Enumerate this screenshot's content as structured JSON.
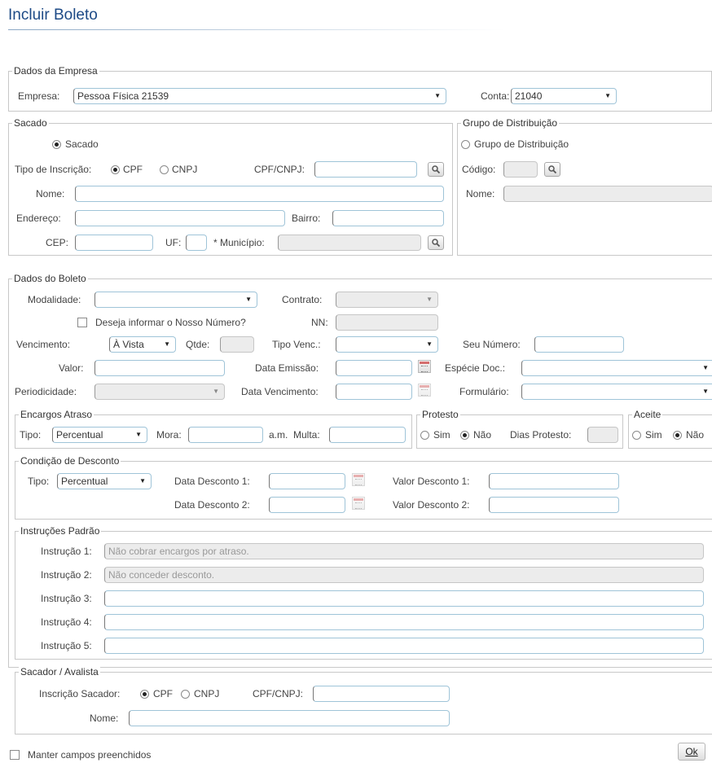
{
  "page": {
    "title": "Incluir Boleto"
  },
  "empresa_section": {
    "legend": "Dados da Empresa",
    "empresa_label": "Empresa:",
    "empresa_value": "Pessoa Física 21539",
    "conta_label": "Conta:",
    "conta_value": "21040"
  },
  "sacado_section": {
    "legend": "Sacado",
    "sacado_radio": "Sacado",
    "tipo_label": "Tipo de Inscrição:",
    "cpf": "CPF",
    "cnpj": "CNPJ",
    "cpf_cnpj_label": "CPF/CNPJ:",
    "nome_label": "Nome:",
    "endereco_label": "Endereço:",
    "bairro_label": "Bairro:",
    "cep_label": "CEP:",
    "uf_label": "UF:",
    "municipio_label": "* Município:"
  },
  "grupo_section": {
    "legend": "Grupo de Distribuição",
    "radio": "Grupo de Distribuição",
    "codigo_label": "Código:",
    "nome_label": "Nome:"
  },
  "boleto_section": {
    "legend": "Dados do Boleto",
    "modalidade_label": "Modalidade:",
    "modalidade_value": "",
    "contrato_label": "Contrato:",
    "nosso_numero_check": "Deseja informar o Nosso Número?",
    "nn_label": "NN:",
    "vencimento_label": "Vencimento:",
    "vencimento_value": "À Vista",
    "qtde_label": "Qtde:",
    "tipo_venc_label": "Tipo Venc.:",
    "seu_numero_label": "Seu Número:",
    "valor_label": "Valor:",
    "data_emissao_label": "Data Emissão:",
    "especie_label": "Espécie Doc.:",
    "periodicidade_label": "Periodicidade:",
    "data_vencimento_label": "Data Vencimento:",
    "formulario_label": "Formulário:"
  },
  "encargos_section": {
    "legend": "Encargos Atraso",
    "tipo_label": "Tipo:",
    "tipo_value": "Percentual",
    "mora_label": "Mora:",
    "am_label": "a.m.",
    "multa_label": "Multa:"
  },
  "protesto_section": {
    "legend": "Protesto",
    "sim": "Sim",
    "nao": "Não",
    "dias_label": "Dias Protesto:"
  },
  "aceite_section": {
    "legend": "Aceite",
    "sim": "Sim",
    "nao": "Não"
  },
  "desconto_section": {
    "legend": "Condição de Desconto",
    "tipo_label": "Tipo:",
    "tipo_value": "Percentual",
    "data1_label": "Data Desconto 1:",
    "data2_label": "Data Desconto 2:",
    "valor1_label": "Valor Desconto 1:",
    "valor2_label": "Valor Desconto 2:"
  },
  "instrucoes_section": {
    "legend": "Instruções Padrão",
    "items": [
      {
        "label": "Instrução 1:",
        "value": "Não cobrar encargos por atraso."
      },
      {
        "label": "Instrução 2:",
        "value": "Não conceder desconto."
      },
      {
        "label": "Instrução 3:",
        "value": ""
      },
      {
        "label": "Instrução 4:",
        "value": ""
      },
      {
        "label": "Instrução 5:",
        "value": ""
      }
    ]
  },
  "sacador_section": {
    "legend": "Sacador / Avalista",
    "inscricao_label": "Inscrição Sacador:",
    "cpf": "CPF",
    "cnpj": "CNPJ",
    "cpf_cnpj_label": "CPF/CNPJ:",
    "nome_label": "Nome:"
  },
  "footer": {
    "manter_label": "Manter campos preenchidos",
    "ok_label": "Ok"
  }
}
